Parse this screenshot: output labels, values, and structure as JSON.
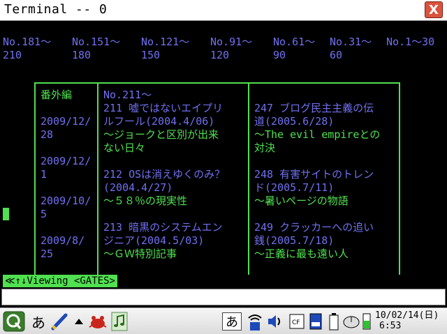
{
  "window": {
    "title": "Terminal -- 0",
    "close_label": "X"
  },
  "nav": [
    {
      "label": "No.181〜",
      "sub": "210"
    },
    {
      "label": "No.151〜",
      "sub": "180"
    },
    {
      "label": "No.121〜",
      "sub": "150"
    },
    {
      "label": "No.91〜",
      "sub": "120"
    },
    {
      "label": "No.61〜",
      "sub": "90"
    },
    {
      "label": "No.31〜",
      "sub": "60"
    },
    {
      "label": "No.1〜30",
      "sub": ""
    }
  ],
  "sidebar": {
    "header": "番外編",
    "dates": [
      [
        "2009/12/",
        "28"
      ],
      [
        "2009/12/",
        "1"
      ],
      [
        "2009/10/",
        "5"
      ],
      [
        "2009/8/",
        "25"
      ]
    ]
  },
  "col2": {
    "header": "No.211〜",
    "entries": [
      {
        "l1": "211 嘘ではないエイプリ",
        "l2": "ルフール(2004.4/06)",
        "d1": "〜ジョークと区別が出来",
        "d2": "ない日々"
      },
      {
        "l1": "212 OSは消えゆくのみ？",
        "l2": "(2004.4/27)",
        "d1": "〜５８％の現実性",
        "d2": ""
      },
      {
        "l1": "213 暗黒のシステムエン",
        "l2": "ジニア(2004.5/03)",
        "d1": "〜ＧＷ特別記事",
        "d2": ""
      }
    ]
  },
  "col3": {
    "entries": [
      {
        "l1": "247 ブログ民主主義の伝",
        "l2": "道(2005.6/28)",
        "d1": "〜The evil empireとの",
        "d2": "対決"
      },
      {
        "l1": "248 有害サイトのトレン",
        "l2": "ド(2005.7/11)",
        "d1": "〜暑いページの物語",
        "d2": ""
      },
      {
        "l1": "249 クラッカーへの追い",
        "l2": "銭(2005.7/18)",
        "d1": "〜正義に最も遠い人",
        "d2": ""
      }
    ]
  },
  "status": {
    "text": "≪↑↓Viewing <GATES>"
  },
  "taskbar": {
    "ime_label": "あ",
    "ime_mode": "あ",
    "clock_date": "10/02/14(日)",
    "clock_time": "6:53"
  },
  "colors": {
    "link": "#7070f0",
    "text": "#50e050",
    "close": "#d9533f"
  }
}
